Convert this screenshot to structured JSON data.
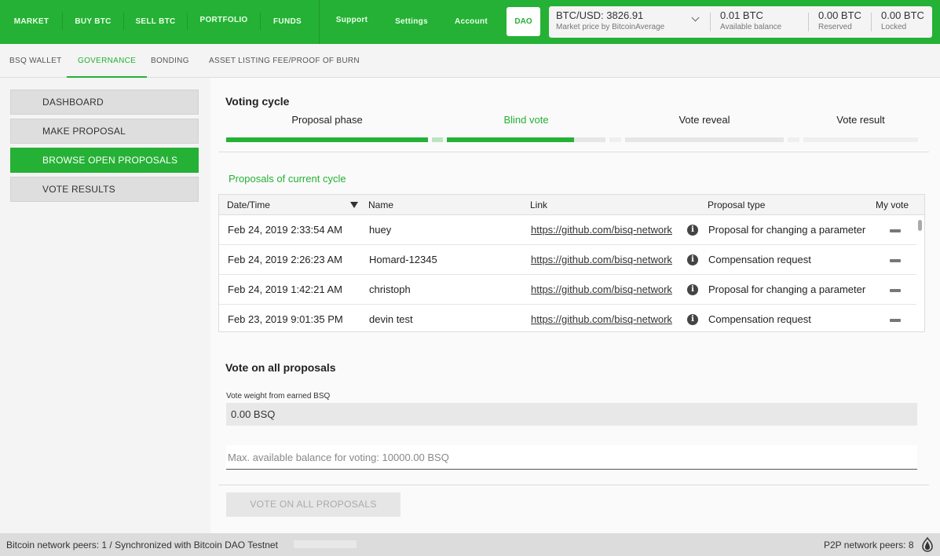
{
  "topnav": {
    "market": "MARKET",
    "buy_btc": "BUY BTC",
    "sell_btc": "SELL BTC",
    "portfolio": "PORTFOLIO",
    "funds": "FUNDS",
    "support": "Support",
    "settings": "Settings",
    "account": "Account",
    "dao": "DAO"
  },
  "balances": {
    "price": "BTC/USD: 3826.91",
    "price_label": "Market price by BitcoinAverage",
    "available": "0.01 BTC",
    "available_label": "Available balance",
    "reserved": "0.00 BTC",
    "reserved_label": "Reserved",
    "locked": "0.00 BTC",
    "locked_label": "Locked"
  },
  "subtabs": [
    "BSQ WALLET",
    "GOVERNANCE",
    "BONDING",
    "ASSET LISTING FEE/PROOF OF BURN"
  ],
  "sidebar": {
    "items": [
      "DASHBOARD",
      "MAKE PROPOSAL",
      "BROWSE OPEN PROPOSALS",
      "VOTE RESULTS"
    ]
  },
  "voting_cycle": {
    "title": "Voting cycle",
    "phases": [
      {
        "label": "Proposal phase",
        "progress": 1.0
      },
      {
        "label": "Blind vote",
        "progress": 0.8
      },
      {
        "label": "Vote reveal",
        "progress": 0.0
      },
      {
        "label": "Vote result",
        "progress": 0.0
      }
    ]
  },
  "proposals": {
    "title": "Proposals of current cycle",
    "columns": [
      "Date/Time",
      "Name",
      "Link",
      "Proposal type",
      "My vote"
    ],
    "rows": [
      {
        "date": "Feb 24, 2019 2:33:54 AM",
        "name": "huey",
        "link": "https://github.com/bisq-network",
        "type": "Proposal for changing a parameter"
      },
      {
        "date": "Feb 24, 2019 2:26:23 AM",
        "name": "Homard-12345",
        "link": "https://github.com/bisq-network",
        "type": "Compensation request"
      },
      {
        "date": "Feb 24, 2019 1:42:21 AM",
        "name": "christoph",
        "link": "https://github.com/bisq-network",
        "type": "Proposal for changing a parameter"
      },
      {
        "date": "Feb 23, 2019 9:01:35 PM",
        "name": "devin test",
        "link": "https://github.com/bisq-network",
        "type": "Compensation request"
      }
    ]
  },
  "vote_all": {
    "title": "Vote on all proposals",
    "weight_label": "Vote weight from earned BSQ",
    "weight_value": "0.00 BSQ",
    "input_placeholder": "Max. available balance for voting: 10000.00 BSQ",
    "button": "VOTE ON ALL PROPOSALS"
  },
  "footer": {
    "left": "Bitcoin network peers: 1 / Synchronized with Bitcoin DAO Testnet",
    "right": "P2P network peers: 8"
  }
}
